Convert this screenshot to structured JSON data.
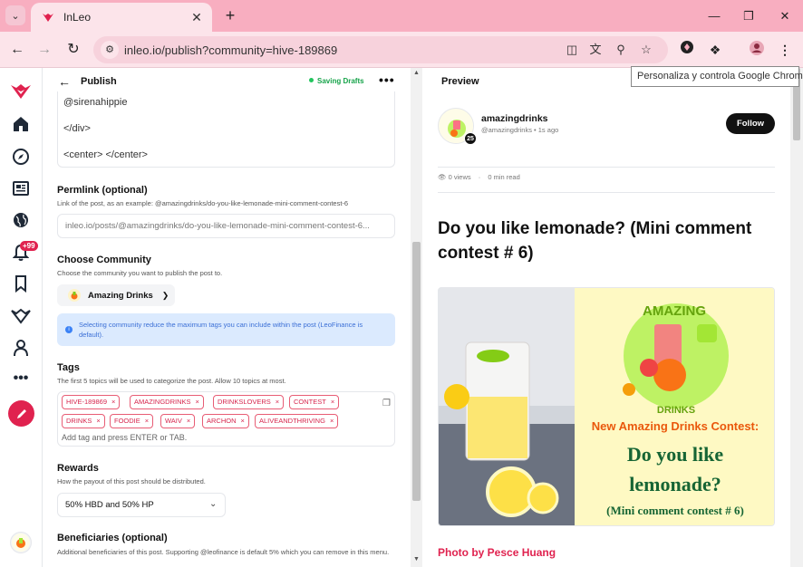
{
  "browser": {
    "tab_title": "InLeo",
    "url": "inleo.io/publish?community=hive-189869",
    "tooltip": "Personaliza y controla Google Chrome"
  },
  "sidebar": {
    "notifications_badge": "+99",
    "items": [
      "leo-logo",
      "home-icon",
      "compass-icon",
      "news-icon",
      "globe-icon",
      "bell-icon",
      "bookmark-icon",
      "leo-icon",
      "profile-icon",
      "more-icon"
    ]
  },
  "editor": {
    "title": "Publish",
    "status": "Saving Drafts",
    "body_lines": [
      "@sirenahippie",
      "</div>",
      "<center> </center>"
    ],
    "permlink": {
      "label": "Permlink (optional)",
      "desc": "Link of the post, as an example: @amazingdrinks/do-you-like-lemonade-mini-comment-contest-6",
      "value": "inleo.io/posts/@amazingdrinks/do-you-like-lemonade-mini-comment-contest-6..."
    },
    "community": {
      "label": "Choose Community",
      "desc": "Choose the community you want to publish the post to.",
      "selected": "Amazing Drinks",
      "info": "Selecting community reduce the maximum tags you can include within the post (LeoFinance is default)."
    },
    "tags": {
      "label": "Tags",
      "desc": "The first 5 topics will be used to categorize the post. Allow 10 topics at most.",
      "items": [
        "HIVE-189869",
        "AMAZINGDRINKS",
        "DRINKSLOVERS",
        "CONTEST",
        "DRINKS",
        "FOODIE",
        "WAIV",
        "ARCHON",
        "ALIVEANDTHRIVING"
      ],
      "placeholder": "Add tag and press ENTER or TAB."
    },
    "rewards": {
      "label": "Rewards",
      "desc": "How the payout of this post should be distributed.",
      "selected": "50% HBD and 50% HP"
    },
    "beneficiaries": {
      "label": "Beneficiaries (optional)",
      "desc": "Additional beneficiaries of this post. Supporting @leofinance is default 5% which you can remove in this menu."
    }
  },
  "preview": {
    "label": "Preview",
    "author": "amazingdrinks",
    "handle": "@amazingdrinks",
    "time": "1s ago",
    "level": "25",
    "follow": "Follow",
    "views": "0 views",
    "read": "0 min read",
    "title": "Do you like lemonade? (Mini comment contest # 6)",
    "image_text": {
      "logo_top": "AMAZING",
      "logo_bottom": "DRINKS",
      "line1": "New Amazing Drinks Contest:",
      "line2": "Do you like",
      "line3": "lemonade?",
      "line4": "(Mini comment contest # 6)"
    },
    "photo_credit": "Photo by Pesce Huang"
  },
  "colors": {
    "brand": "#e0224f",
    "chrome_tab": "#f8aec0",
    "info_bg": "#dbeafe"
  }
}
